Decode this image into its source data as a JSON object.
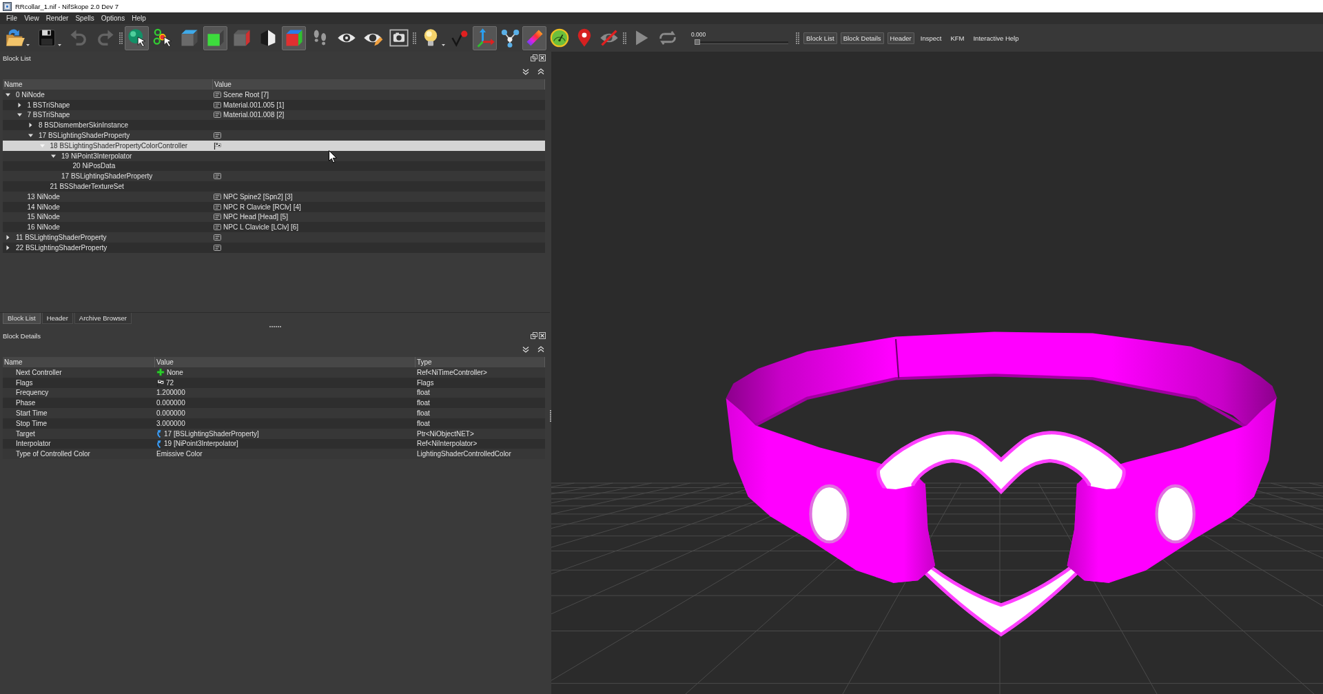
{
  "window": {
    "title": "RRcollar_1.nif - NifSkope 2.0 Dev 7"
  },
  "menu": [
    "File",
    "View",
    "Render",
    "Spells",
    "Options",
    "Help"
  ],
  "toolbar": {
    "groups": [
      [
        {
          "kind": "open",
          "on": false,
          "disabled": false,
          "dropdown": true
        },
        {
          "kind": "save",
          "on": false,
          "disabled": false,
          "dropdown": true
        },
        {
          "kind": "undo",
          "on": false,
          "disabled": true,
          "dropdown": false
        },
        {
          "kind": "redo",
          "on": false,
          "disabled": true,
          "dropdown": false
        }
      ],
      [
        {
          "kind": "select_object",
          "on": true,
          "disabled": false,
          "dropdown": false
        },
        {
          "kind": "select_vertex",
          "on": false,
          "disabled": false,
          "dropdown": false
        },
        {
          "kind": "view_top",
          "on": false,
          "disabled": false,
          "dropdown": false
        },
        {
          "kind": "view_front",
          "on": true,
          "disabled": false,
          "dropdown": false
        },
        {
          "kind": "view_side",
          "on": false,
          "disabled": false,
          "dropdown": false
        },
        {
          "kind": "perspective",
          "on": false,
          "disabled": false,
          "dropdown": false
        },
        {
          "kind": "view_user",
          "on": true,
          "disabled": false,
          "dropdown": false
        },
        {
          "kind": "footsteps",
          "on": false,
          "disabled": false,
          "dropdown": false
        },
        {
          "kind": "show_hidden",
          "on": false,
          "disabled": false,
          "dropdown": false
        },
        {
          "kind": "edit_visibility",
          "on": false,
          "disabled": false,
          "dropdown": false
        },
        {
          "kind": "screenshot",
          "on": false,
          "disabled": false,
          "dropdown": false
        }
      ],
      [
        {
          "kind": "lighting",
          "on": false,
          "disabled": false,
          "dropdown": true
        },
        {
          "kind": "vertices",
          "on": false,
          "disabled": false,
          "dropdown": false
        },
        {
          "kind": "axes",
          "on": true,
          "disabled": false,
          "dropdown": false
        },
        {
          "kind": "nodes",
          "on": false,
          "disabled": false,
          "dropdown": false
        },
        {
          "kind": "tangents",
          "on": true,
          "disabled": false,
          "dropdown": false
        },
        {
          "kind": "gauge",
          "on": false,
          "disabled": false,
          "dropdown": false
        },
        {
          "kind": "marker",
          "on": false,
          "disabled": false,
          "dropdown": false
        },
        {
          "kind": "hide_crossed",
          "on": false,
          "disabled": false,
          "dropdown": false
        }
      ],
      [
        {
          "kind": "play",
          "on": false,
          "disabled": false,
          "dropdown": false
        },
        {
          "kind": "loop",
          "on": false,
          "disabled": false,
          "dropdown": false
        }
      ]
    ],
    "time": {
      "reading": "0.000",
      "level": 0
    },
    "dock_toggles": [
      {
        "label": "Block List",
        "checked": true
      },
      {
        "label": "Block Details",
        "checked": true
      },
      {
        "label": "Header",
        "checked": true
      },
      {
        "label": "Inspect",
        "checked": false
      },
      {
        "label": "KFM",
        "checked": false
      },
      {
        "label": "Interactive Help",
        "checked": false
      }
    ]
  },
  "block_list": {
    "title": "Block List",
    "columns": [
      "Name",
      "Value"
    ],
    "rows": [
      {
        "name": "0 NiNode",
        "value": "Scene Root [7]",
        "kind": "string",
        "expanded": true,
        "selected": false,
        "children": [
          {
            "name": "1 BSTriShape",
            "value": "Material.001.005 [1]",
            "kind": "string",
            "expanded": false,
            "selected": false
          },
          {
            "name": "7 BSTriShape",
            "value": "Material.001.008 [2]",
            "kind": "string",
            "expanded": true,
            "selected": false,
            "children": [
              {
                "name": "8 BSDismemberSkinInstance",
                "kind": "plain",
                "expanded": false,
                "selected": false
              },
              {
                "name": "17 BSLightingShaderProperty",
                "kind": "string",
                "expanded": true,
                "selected": false,
                "children": [
                  {
                    "name": "18 BSLightingShaderPropertyColorController",
                    "kind": "flags",
                    "expanded": true,
                    "selected": true,
                    "children": [
                      {
                        "name": "19 NiPoint3Interpolator",
                        "kind": "plain",
                        "expanded": true,
                        "selected": false,
                        "children": [
                          {
                            "name": "20 NiPosData",
                            "kind": "plain",
                            "selected": false
                          }
                        ]
                      },
                      {
                        "name": "17 BSLightingShaderProperty",
                        "kind": "string",
                        "selected": false
                      }
                    ]
                  },
                  {
                    "name": "21 BSShaderTextureSet",
                    "kind": "plain",
                    "selected": false
                  }
                ]
              }
            ]
          },
          {
            "name": "13 NiNode",
            "value": "NPC Spine2 [Spn2] [3]",
            "kind": "string",
            "selected": false
          },
          {
            "name": "14 NiNode",
            "value": "NPC R Clavicle [RClv] [4]",
            "kind": "string",
            "selected": false
          },
          {
            "name": "15 NiNode",
            "value": "NPC Head [Head] [5]",
            "kind": "string",
            "selected": false
          },
          {
            "name": "16 NiNode",
            "value": "NPC L Clavicle [LClv] [6]",
            "kind": "string",
            "selected": false
          }
        ]
      },
      {
        "name": "11 BSLightingShaderProperty",
        "kind": "string",
        "expanded": false,
        "selected": false
      },
      {
        "name": "22 BSLightingShaderProperty",
        "kind": "string",
        "expanded": false,
        "selected": false
      }
    ]
  },
  "dock_tabs": [
    {
      "label": "Block List",
      "selected": true
    },
    {
      "label": "Header",
      "selected": false
    },
    {
      "label": "Archive Browser",
      "selected": false
    }
  ],
  "block_details": {
    "title": "Block Details",
    "columns": [
      "Name",
      "Value",
      "Type"
    ],
    "rows": [
      {
        "name": "Next Controller",
        "value": "None",
        "kind": "add",
        "type": "Ref<NiTimeController>"
      },
      {
        "name": "Flags",
        "value": "72",
        "kind": "flags",
        "type": "Flags"
      },
      {
        "name": "Frequency",
        "value": "1.200000",
        "kind": "plain",
        "type": "float"
      },
      {
        "name": "Phase",
        "value": "0.000000",
        "kind": "plain",
        "type": "float"
      },
      {
        "name": "Start Time",
        "value": "0.000000",
        "kind": "plain",
        "type": "float"
      },
      {
        "name": "Stop Time",
        "value": "3.000000",
        "kind": "plain",
        "type": "float"
      },
      {
        "name": "Target",
        "value": "17 [BSLightingShaderProperty]",
        "kind": "link",
        "type": "Ptr<NiObjectNET>"
      },
      {
        "name": "Interpolator",
        "value": "19 [NiPoint3Interpolator]",
        "kind": "link",
        "type": "Ref<NiInterpolator>"
      },
      {
        "name": "Type of Controlled Color",
        "value": "Emissive Color",
        "kind": "plain",
        "type": "LightingShaderControlledColor"
      }
    ]
  }
}
